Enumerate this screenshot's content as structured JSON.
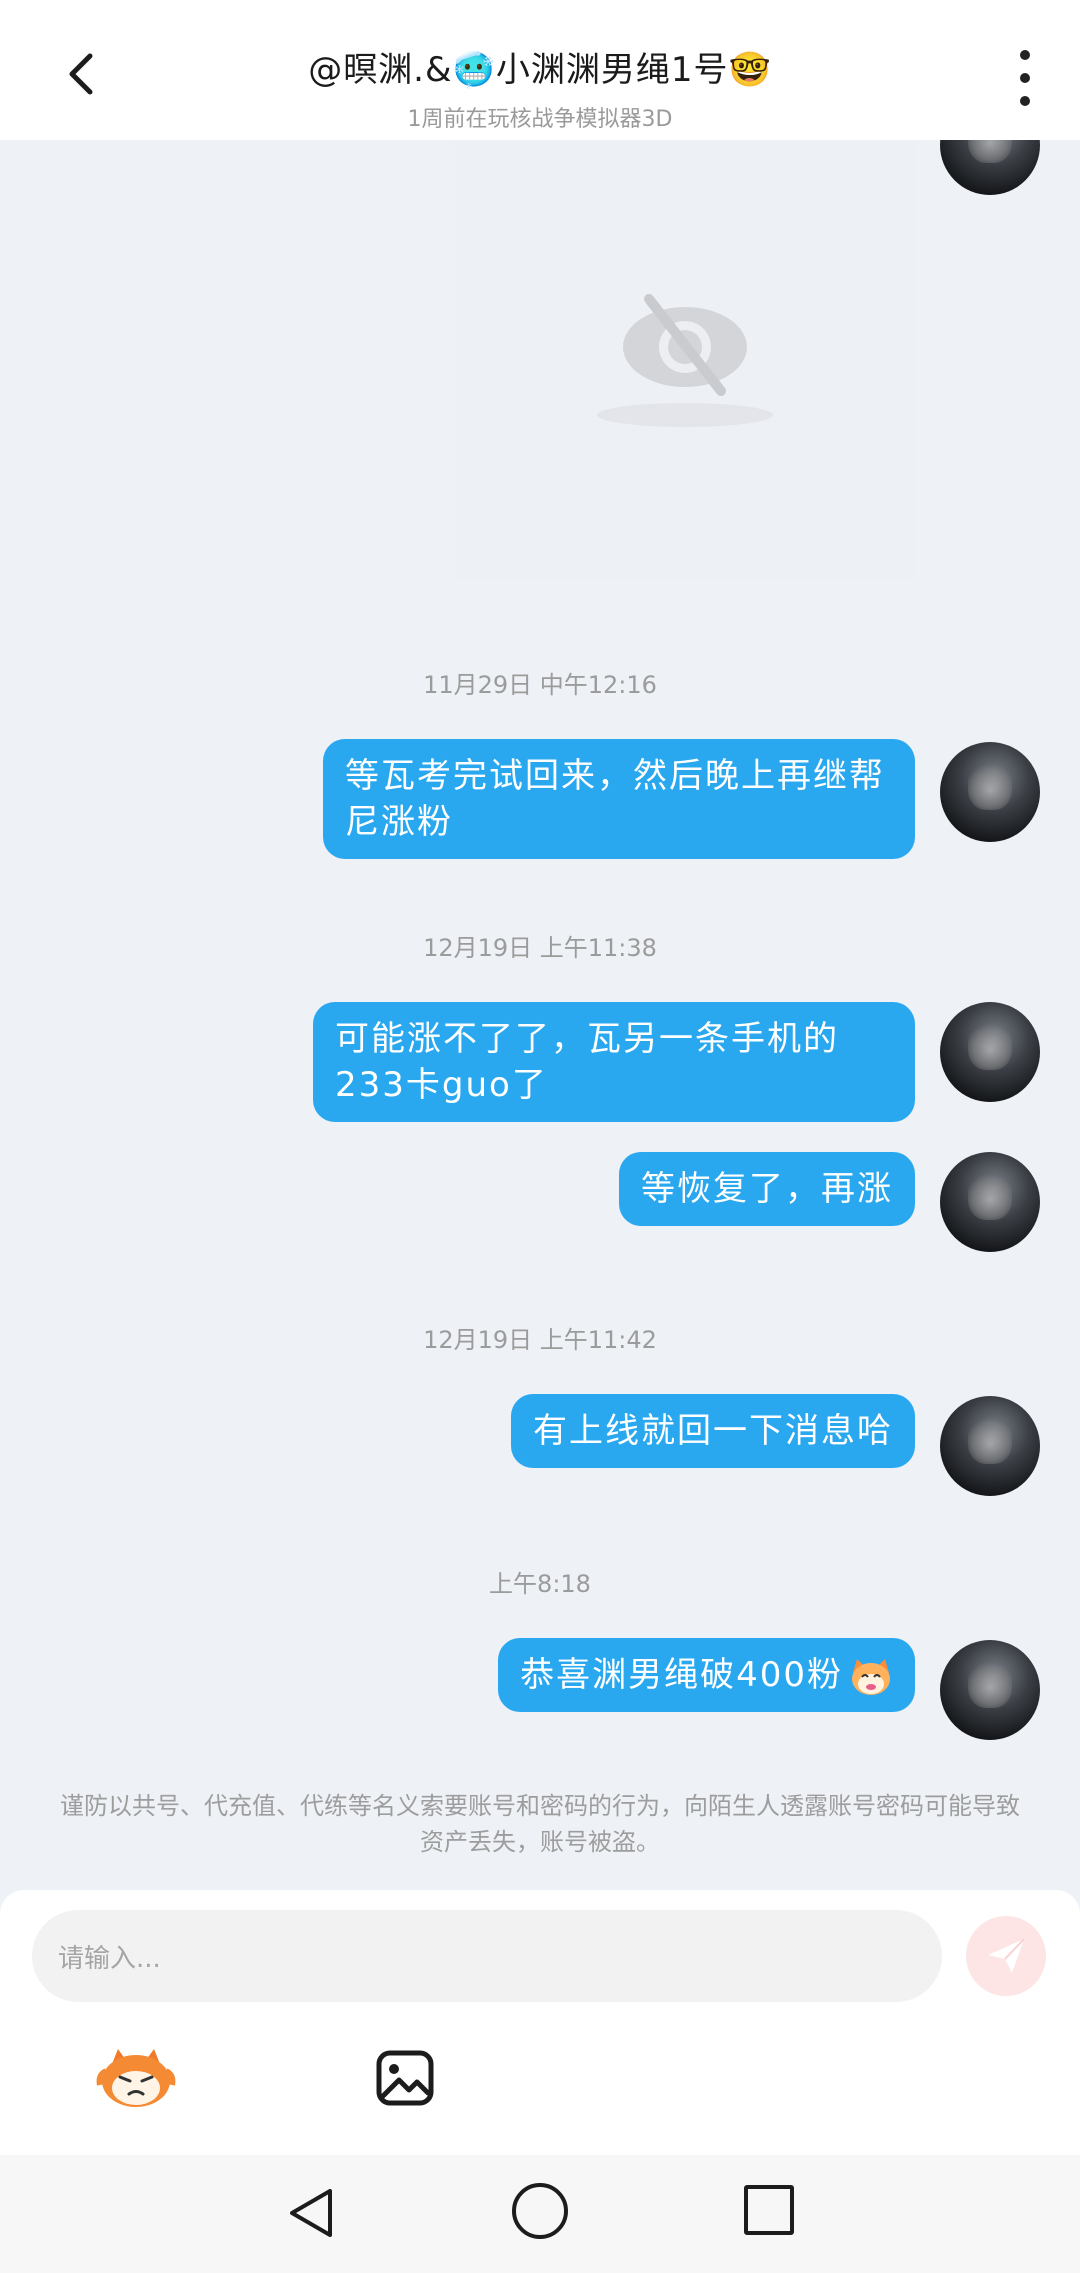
{
  "header": {
    "title": "@暝渊.&🥶小渊渊男绳1号🤓",
    "subtitle": "1周前在玩核战争模拟器3D"
  },
  "messages": [
    {
      "timestamp": "11月29日 中午12:16",
      "text": "等瓦考完试回来，然后晚上再继帮尼涨粉"
    },
    {
      "timestamp": "12月19日 上午11:38",
      "text": "可能涨不了了，瓦另一条手机的233卡guo了"
    },
    {
      "timestamp": "",
      "text": "等恢复了，再涨"
    },
    {
      "timestamp": "12月19日 上午11:42",
      "text": "有上线就回一下消息哈"
    },
    {
      "timestamp": "上午8:18",
      "text": "恭喜渊男绳破400粉"
    }
  ],
  "notice": "谨防以共号、代充值、代练等名义索要账号和密码的行为，向陌生人透露账号密码可能导致资产丢失，账号被盗。",
  "input": {
    "placeholder": "请输入..."
  },
  "icons": {
    "back": "chevron-left-icon",
    "more": "vertical-dots-icon",
    "hidden_image": "eye-off-icon",
    "send": "paper-plane-icon",
    "mascot": "mascot-emoji-icon",
    "image": "image-picker-icon"
  },
  "colors": {
    "bubble": "#29a8f0",
    "background": "#eef1f6",
    "send_disabled": "#fde5e5"
  }
}
